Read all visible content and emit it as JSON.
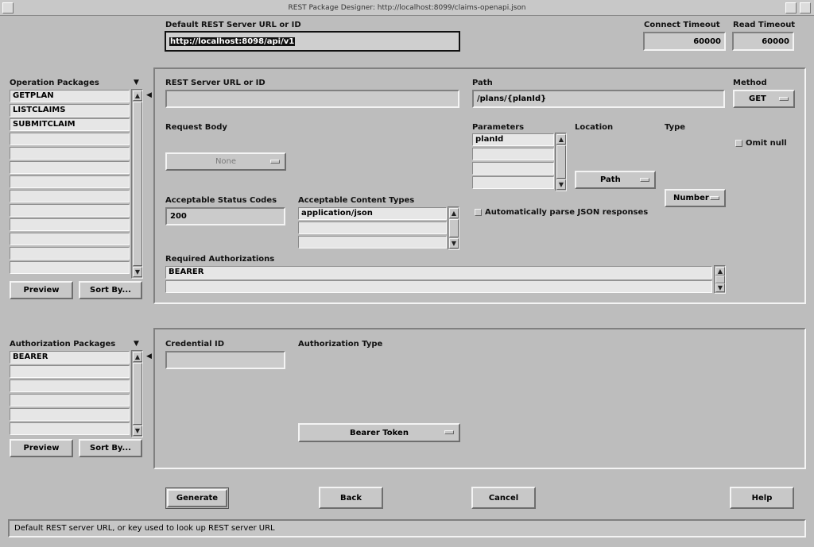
{
  "window": {
    "title": "REST Package Designer: http://localhost:8099/claims-openapi.json"
  },
  "top": {
    "default_url_label": "Default REST Server URL or ID",
    "default_url_value": "http://localhost:8098/api/v1",
    "connect_timeout_label": "Connect Timeout",
    "connect_timeout_value": "60000",
    "read_timeout_label": "Read Timeout",
    "read_timeout_value": "60000"
  },
  "operations": {
    "label": "Operation Packages",
    "items": [
      "GETPLAN",
      "LISTCLAIMS",
      "SUBMITCLAIM",
      "",
      "",
      "",
      "",
      "",
      "",
      "",
      "",
      "",
      ""
    ],
    "preview_label": "Preview",
    "sortby_label": "Sort By..."
  },
  "operation_detail": {
    "server_url_label": "REST Server URL or ID",
    "server_url_value": "",
    "path_label": "Path",
    "path_value": "/plans/{planId}",
    "method_label": "Method",
    "method_value": "GET",
    "request_body_label": "Request Body",
    "request_body_value": "None",
    "parameters_label": "Parameters",
    "parameters": [
      "planId",
      "",
      "",
      ""
    ],
    "location_label": "Location",
    "location_value": "Path",
    "type_label": "Type",
    "type_value": "Number",
    "omit_null_label": "Omit null",
    "status_codes_label": "Acceptable Status Codes",
    "status_codes_value": "200",
    "content_types_label": "Acceptable Content Types",
    "content_types": [
      "application/json",
      "",
      ""
    ],
    "auto_parse_label": "Automatically parse JSON responses",
    "required_auth_label": "Required Authorizations",
    "required_auth": [
      "BEARER",
      ""
    ]
  },
  "authorizations": {
    "label": "Authorization Packages",
    "items": [
      "BEARER",
      "",
      "",
      "",
      "",
      ""
    ],
    "preview_label": "Preview",
    "sortby_label": "Sort By..."
  },
  "auth_detail": {
    "credential_label": "Credential ID",
    "credential_value": "",
    "auth_type_label": "Authorization Type",
    "auth_type_value": "Bearer Token"
  },
  "buttons": {
    "generate": "Generate",
    "back": "Back",
    "cancel": "Cancel",
    "help": "Help"
  },
  "status": {
    "text": "Default REST server URL, or key used to look up REST server URL"
  }
}
